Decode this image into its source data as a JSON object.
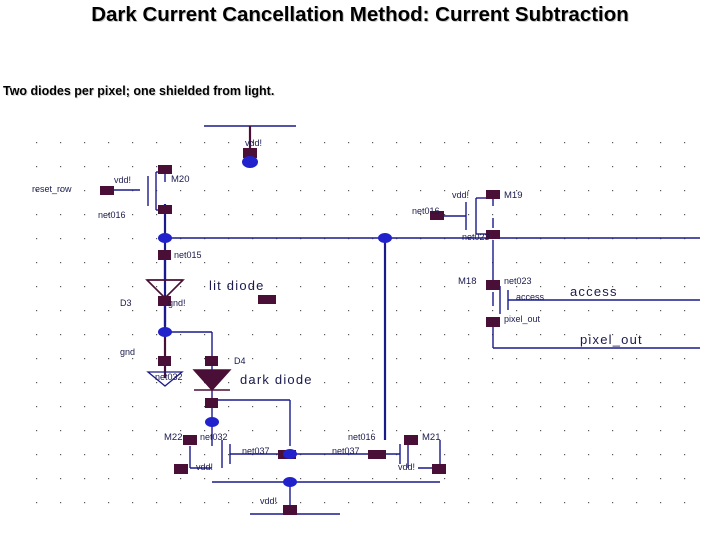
{
  "slide": {
    "title": "Dark Current Cancellation Method: Current Subtraction",
    "body_text": "Two diodes per pixel; one shielded from light."
  },
  "colors": {
    "wire": "#1a1a8c",
    "pin": "#4a0f36",
    "junction": "#2222cc",
    "label": "#1a1a4e",
    "grid_dot": "#555555",
    "background": "#ffffff"
  },
  "schematic": {
    "name": "current-subtraction-pixel-schematic",
    "grid": {
      "spacing": 24,
      "dot_color": "#555555"
    },
    "power_symbols": [
      {
        "id": "vdd-top",
        "label": "vdd!"
      },
      {
        "id": "vdd-bottom",
        "label": "vdd!"
      },
      {
        "id": "gnd-diode",
        "label": "gnd!"
      },
      {
        "id": "gnd-left",
        "label": "gnd"
      }
    ],
    "nets": [
      {
        "id": "net-reset-row",
        "label": "reset_row"
      },
      {
        "id": "net016-top",
        "label": "net016"
      },
      {
        "id": "net015-diode",
        "label": "net015"
      },
      {
        "id": "net032-dark",
        "label": "net032"
      },
      {
        "id": "net016-right",
        "label": "net016"
      },
      {
        "id": "net023-right",
        "label": "net023"
      },
      {
        "id": "net023-m18",
        "label": "net023"
      },
      {
        "id": "net032-m22",
        "label": "net032"
      },
      {
        "id": "net037-left",
        "label": "net037"
      },
      {
        "id": "net037-right",
        "label": "net037"
      },
      {
        "id": "net016-m21",
        "label": "net016"
      },
      {
        "id": "net-access-pin",
        "label": "access"
      },
      {
        "id": "net-pixel-out-pin",
        "label": "pixel_out"
      }
    ],
    "devices": [
      {
        "id": "M20",
        "label": "M20",
        "type": "pmos"
      },
      {
        "id": "M19",
        "label": "M19",
        "type": "pmos"
      },
      {
        "id": "M18",
        "label": "M18",
        "type": "nmos"
      },
      {
        "id": "M22",
        "label": "M22",
        "type": "nmos"
      },
      {
        "id": "M21",
        "label": "M21",
        "type": "nmos"
      },
      {
        "id": "D3",
        "label": "D3",
        "type": "diode-open"
      },
      {
        "id": "D4",
        "label": "D4",
        "type": "diode-filled"
      }
    ],
    "supply_labels": [
      {
        "id": "vdd-m20",
        "label": "vdd!"
      },
      {
        "id": "vdd-m19",
        "label": "vdd!"
      },
      {
        "id": "vdd-m22",
        "label": "vdd!"
      },
      {
        "id": "vdd-m21",
        "label": "vdd!"
      }
    ],
    "annotations": [
      {
        "id": "lit-diode-note",
        "label": "lit diode"
      },
      {
        "id": "dark-diode-note",
        "label": "dark diode"
      },
      {
        "id": "access-port",
        "label": "access"
      },
      {
        "id": "pixel-out-port",
        "label": "pixel_out"
      }
    ]
  }
}
